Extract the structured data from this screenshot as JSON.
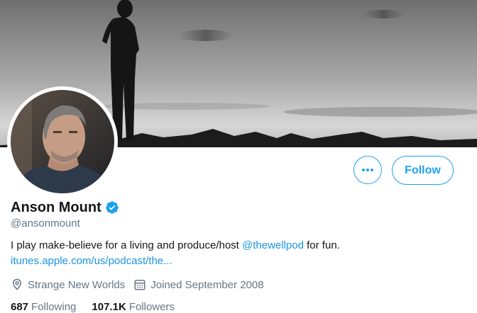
{
  "profile": {
    "display_name": "Anson Mount",
    "handle": "@ansonmount",
    "verified": true,
    "bio": {
      "before": "I play make-believe for a living and produce/host ",
      "mention": "@thewellpod",
      "after": " for fun."
    },
    "website": "itunes.apple.com/us/podcast/the...",
    "location": "Strange New Worlds",
    "joined": "Joined September 2008"
  },
  "actions": {
    "more_label": "More",
    "follow_label": "Follow"
  },
  "stats": {
    "following_count": "687",
    "following_label": "Following",
    "followers_count": "107.1K",
    "followers_label": "Followers"
  },
  "colors": {
    "accent": "#1da1f2",
    "link": "#1b95e0",
    "secondary_text": "#657786",
    "primary_text": "#14171a"
  },
  "icons": {
    "more": "ellipsis-icon",
    "verified": "verified-badge-icon",
    "location": "location-pin-icon",
    "joined": "calendar-icon"
  }
}
